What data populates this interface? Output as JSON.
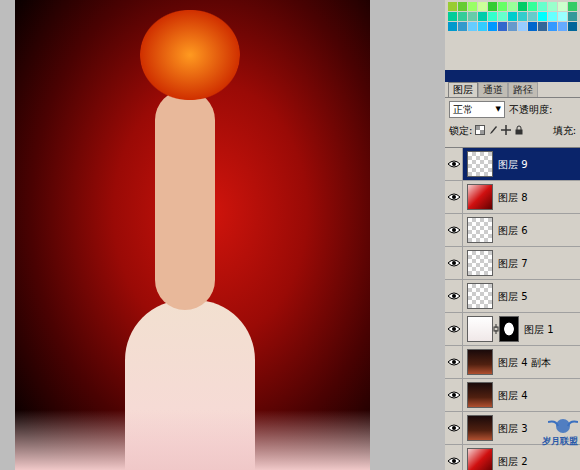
{
  "swatches": [
    {
      "color": "#99cc33"
    },
    {
      "color": "#66cc33"
    },
    {
      "color": "#99ff66"
    },
    {
      "color": "#ccff99"
    },
    {
      "color": "#33cc33"
    },
    {
      "color": "#66ff66"
    },
    {
      "color": "#99ff99"
    },
    {
      "color": "#00cc66"
    },
    {
      "color": "#33ff99"
    },
    {
      "color": "#66ffcc"
    },
    {
      "color": "#99ffcc"
    },
    {
      "color": "#ccffcc"
    },
    {
      "color": "#33cc66"
    },
    {
      "color": "#00cc99"
    },
    {
      "color": "#33cc99"
    },
    {
      "color": "#66ccaa"
    },
    {
      "color": "#00ccaa"
    },
    {
      "color": "#33ffcc"
    },
    {
      "color": "#66ffcc"
    },
    {
      "color": "#00cccc"
    },
    {
      "color": "#33cccc"
    },
    {
      "color": "#66cccc"
    },
    {
      "color": "#00ffff"
    },
    {
      "color": "#66ffff"
    },
    {
      "color": "#99ffff"
    },
    {
      "color": "#339999"
    },
    {
      "color": "#0099cc"
    },
    {
      "color": "#3399cc"
    },
    {
      "color": "#66ccff"
    },
    {
      "color": "#33ccff"
    },
    {
      "color": "#0099ff"
    },
    {
      "color": "#3366cc"
    },
    {
      "color": "#6699cc"
    },
    {
      "color": "#99ccff"
    },
    {
      "color": "#0066cc"
    },
    {
      "color": "#336699"
    },
    {
      "color": "#3399ff"
    },
    {
      "color": "#66aaff"
    },
    {
      "color": "#006699"
    }
  ],
  "panel": {
    "tabs": [
      {
        "label": "图层",
        "selected": true
      },
      {
        "label": "通道",
        "selected": false
      },
      {
        "label": "路径",
        "selected": false
      }
    ],
    "blend_mode": "正常",
    "dropdown_arrow": "▼",
    "opacity_label": "不透明度:",
    "lock_label": "锁定:",
    "fill_label": "填充:"
  },
  "layers": [
    {
      "name": "图层 9",
      "visible": true,
      "selected": true,
      "kind": "transparent"
    },
    {
      "name": "图层 8",
      "visible": true,
      "selected": false,
      "kind": "red"
    },
    {
      "name": "图层 6",
      "visible": true,
      "selected": false,
      "kind": "transparent"
    },
    {
      "name": "图层 7",
      "visible": true,
      "selected": false,
      "kind": "transparent"
    },
    {
      "name": "图层 5",
      "visible": true,
      "selected": false,
      "kind": "transparent"
    },
    {
      "name": "图层 1",
      "visible": true,
      "selected": false,
      "kind": "masked"
    },
    {
      "name": "图层 4 副本",
      "visible": true,
      "selected": false,
      "kind": "dark"
    },
    {
      "name": "图层 4",
      "visible": true,
      "selected": false,
      "kind": "dark"
    },
    {
      "name": "图层 3",
      "visible": true,
      "selected": false,
      "kind": "dark"
    },
    {
      "name": "图层 2",
      "visible": true,
      "selected": false,
      "kind": "red"
    }
  ],
  "watermark": {
    "text": "岁月联盟"
  }
}
